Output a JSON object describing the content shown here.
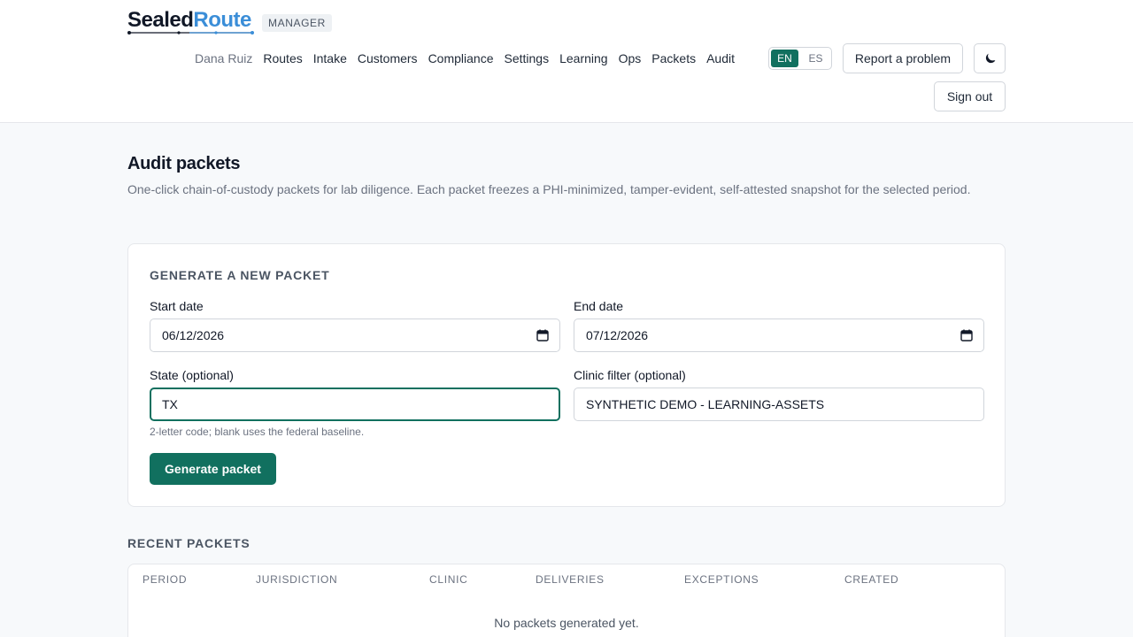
{
  "brand": {
    "name_part1": "Sealed",
    "name_part2": "Route",
    "role": "MANAGER"
  },
  "nav": {
    "user": "Dana Ruiz",
    "links": [
      "Routes",
      "Intake",
      "Customers",
      "Compliance",
      "Settings",
      "Learning",
      "Ops",
      "Packets",
      "Audit"
    ]
  },
  "lang": {
    "en": "EN",
    "es": "ES",
    "active": "EN"
  },
  "header_actions": {
    "report": "Report a problem",
    "theme_icon": "moon-icon",
    "signout": "Sign out"
  },
  "page": {
    "title": "Audit packets",
    "description": "One-click chain-of-custody packets for lab diligence. Each packet freezes a PHI-minimized, tamper-evident, self-attested snapshot for the selected period."
  },
  "form": {
    "section_title": "GENERATE A NEW PACKET",
    "start_label": "Start date",
    "start_value": "06/12/2026",
    "end_label": "End date",
    "end_value": "07/12/2026",
    "state_label": "State (optional)",
    "state_value": "TX",
    "state_hint": "2-letter code; blank uses the federal baseline.",
    "clinic_label": "Clinic filter (optional)",
    "clinic_value": "SYNTHETIC DEMO - LEARNING-ASSETS",
    "submit": "Generate packet"
  },
  "recent": {
    "title": "RECENT PACKETS",
    "columns": [
      "PERIOD",
      "JURISDICTION",
      "CLINIC",
      "DELIVERIES",
      "EXCEPTIONS",
      "CREATED"
    ],
    "empty": "No packets generated yet."
  },
  "colors": {
    "primary": "#11705f",
    "brand_blue": "#3b8ed8",
    "background": "#f7f9fb"
  }
}
